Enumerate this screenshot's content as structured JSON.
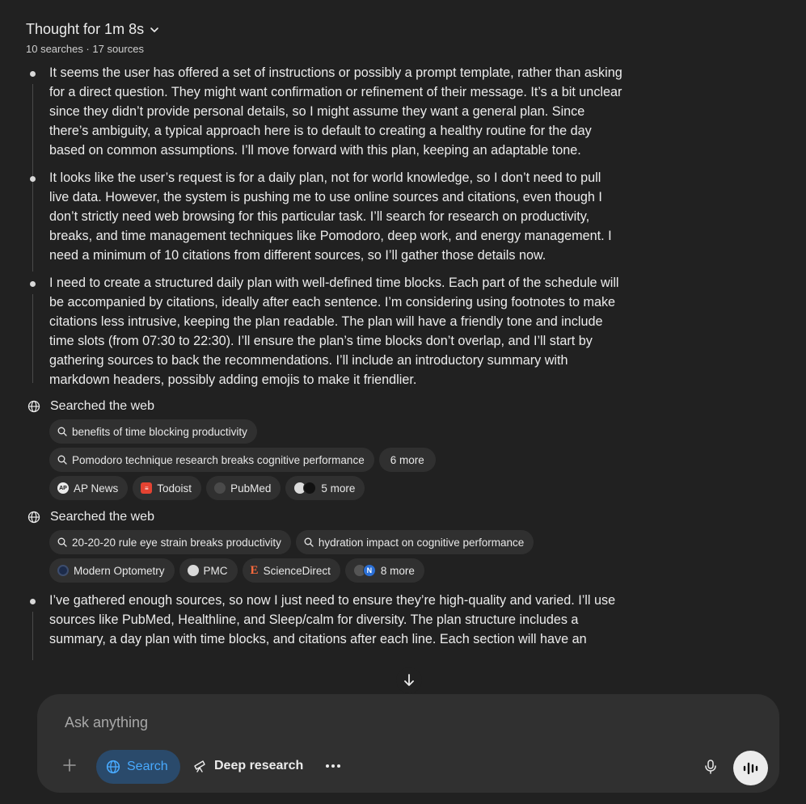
{
  "thought": {
    "title": "Thought for 1m 8s",
    "meta": "10 searches · 17 sources"
  },
  "steps": [
    "It seems the user has offered a set of instructions or possibly a prompt template, rather than asking for a direct question. They might want confirmation or refinement of their message. It’s a bit unclear since they didn’t provide personal details, so I might assume they want a general plan. Since there’s ambiguity, a typical approach here is to default to creating a healthy routine for the day based on common assumptions. I’ll move forward with this plan, keeping an adaptable tone.",
    "It looks like the user’s request is for a daily plan, not for world knowledge, so I don’t need to pull live data. However, the system is pushing me to use online sources and citations, even though I don’t strictly need web browsing for this particular task. I’ll search for research on productivity, breaks, and time management techniques like Pomodoro, deep work, and energy management. I need a minimum of 10 citations from different sources, so I’ll gather those details now.",
    "I need to create a structured daily plan with well-defined time blocks. Each part of the schedule will be accompanied by citations, ideally after each sentence. I’m considering using footnotes to make citations less intrusive, keeping the plan readable. The plan will have a friendly tone and include time slots (from 07:30 to 22:30). I’ll ensure the plan’s time blocks don’t overlap, and I’ll start by gathering sources to back the recommendations. I’ll include an introductory summary with markdown headers, possibly adding emojis to make it friendlier.",
    "I’ve gathered enough sources, so now I just need to ensure they’re high-quality and varied. I’ll use sources like PubMed, Healthline, and Sleep/calm for diversity. The plan structure includes a summary, a day plan with time blocks, and citations after each line. Each section will have an"
  ],
  "search1": {
    "label": "Searched the web",
    "query1": "benefits of time blocking productivity",
    "query2": "Pomodoro technique research breaks cognitive performance",
    "more_queries": "6 more",
    "source1": "AP News",
    "source2": "Todoist",
    "source3": "PubMed",
    "more_sources": "5 more"
  },
  "search2": {
    "label": "Searched the web",
    "query1": "20-20-20 rule eye strain breaks productivity",
    "query2": "hydration impact on cognitive performance",
    "source1": "Modern Optometry",
    "source2": "PMC",
    "source3": "ScienceDirect",
    "more_sources": "8 more"
  },
  "composer": {
    "placeholder": "Ask anything",
    "search_label": "Search",
    "deep_research_label": "Deep research"
  },
  "colors": {
    "background": "#212121",
    "composer": "#303030",
    "chip": "#303030",
    "accent": "#48aaff",
    "search_pill": "#2a4a6b"
  }
}
